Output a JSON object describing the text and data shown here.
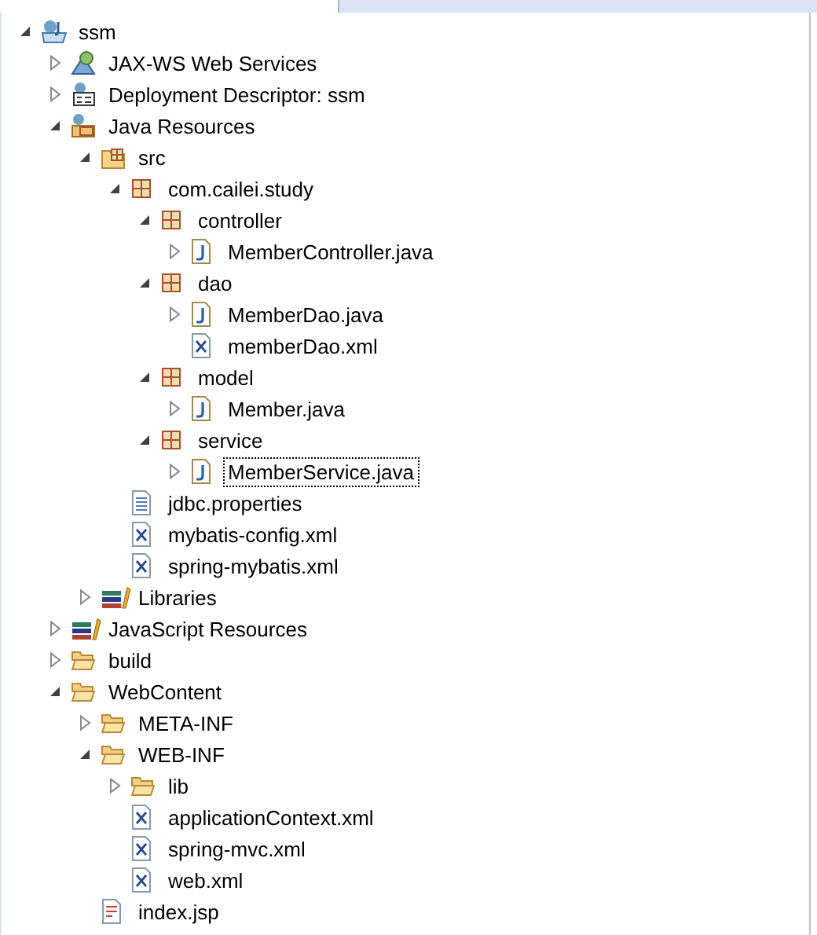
{
  "tree": [
    {
      "label": "ssm",
      "kind": "project",
      "expanded": true,
      "selected": false,
      "children": [
        {
          "label": "JAX-WS Web Services",
          "kind": "webservices",
          "expanded": false,
          "selected": false
        },
        {
          "label": "Deployment Descriptor: ssm",
          "kind": "descriptor",
          "expanded": false,
          "selected": false
        },
        {
          "label": "Java Resources",
          "kind": "javaresources",
          "expanded": true,
          "selected": false,
          "children": [
            {
              "label": "src",
              "kind": "srcfolder",
              "expanded": true,
              "selected": false,
              "children": [
                {
                  "label": "com.cailei.study",
                  "kind": "package",
                  "expanded": true,
                  "selected": false,
                  "children": [
                    {
                      "label": "controller",
                      "kind": "package",
                      "expanded": true,
                      "selected": false,
                      "children": [
                        {
                          "label": "MemberController.java",
                          "kind": "java",
                          "expanded": false,
                          "selected": false
                        }
                      ]
                    },
                    {
                      "label": "dao",
                      "kind": "package",
                      "expanded": true,
                      "selected": false,
                      "children": [
                        {
                          "label": "MemberDao.java",
                          "kind": "java",
                          "expanded": false,
                          "selected": false
                        },
                        {
                          "label": "memberDao.xml",
                          "kind": "xml",
                          "selected": false
                        }
                      ]
                    },
                    {
                      "label": "model",
                      "kind": "package",
                      "expanded": true,
                      "selected": false,
                      "children": [
                        {
                          "label": "Member.java",
                          "kind": "java",
                          "expanded": false,
                          "selected": false
                        }
                      ]
                    },
                    {
                      "label": "service",
                      "kind": "package",
                      "expanded": true,
                      "selected": false,
                      "children": [
                        {
                          "label": "MemberService.java",
                          "kind": "java",
                          "expanded": false,
                          "selected": true
                        }
                      ]
                    }
                  ]
                },
                {
                  "label": "jdbc.properties",
                  "kind": "properties",
                  "selected": false
                },
                {
                  "label": "mybatis-config.xml",
                  "kind": "xml",
                  "selected": false
                },
                {
                  "label": "spring-mybatis.xml",
                  "kind": "xml",
                  "selected": false
                }
              ]
            },
            {
              "label": "Libraries",
              "kind": "library",
              "expanded": false,
              "selected": false
            }
          ]
        },
        {
          "label": "JavaScript Resources",
          "kind": "library",
          "expanded": false,
          "selected": false
        },
        {
          "label": "build",
          "kind": "folder",
          "expanded": false,
          "selected": false
        },
        {
          "label": "WebContent",
          "kind": "folder",
          "expanded": true,
          "selected": false,
          "children": [
            {
              "label": "META-INF",
              "kind": "folder",
              "expanded": false,
              "selected": false
            },
            {
              "label": "WEB-INF",
              "kind": "folder",
              "expanded": true,
              "selected": false,
              "children": [
                {
                  "label": "lib",
                  "kind": "folder",
                  "expanded": false,
                  "selected": false
                },
                {
                  "label": "applicationContext.xml",
                  "kind": "xml",
                  "selected": false
                },
                {
                  "label": "spring-mvc.xml",
                  "kind": "xml",
                  "selected": false
                },
                {
                  "label": "web.xml",
                  "kind": "xml",
                  "selected": false
                }
              ]
            },
            {
              "label": "index.jsp",
              "kind": "jsp",
              "selected": false
            }
          ]
        }
      ]
    }
  ]
}
